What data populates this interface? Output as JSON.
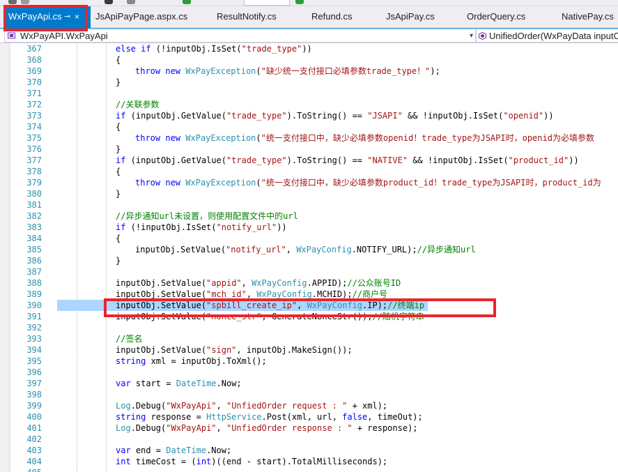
{
  "tabs": [
    {
      "label": "WxPayApi.cs",
      "active": true
    },
    {
      "label": "JsApiPayPage.aspx.cs"
    },
    {
      "label": "ResultNotify.cs"
    },
    {
      "label": "Refund.cs"
    },
    {
      "label": "JsApiPay.cs"
    },
    {
      "label": "OrderQuery.cs"
    },
    {
      "label": "NativePay.cs"
    }
  ],
  "tab_icons": {
    "pin": "pin-icon",
    "close": "close-icon"
  },
  "navbar": {
    "class_scope": "WxPayAPI.WxPayApi",
    "member_scope": "UnifiedOrder(WxPayData inputOb"
  },
  "colors": {
    "accent": "#007acc",
    "line_numbers": "#2b91af",
    "keyword": "#0000ff",
    "string": "#a31515",
    "type": "#2b91af",
    "comment": "#008000",
    "selection": "#add6ff",
    "annotation_red": "#e8262b"
  },
  "code": [
    {
      "num": "367",
      "indent": 3,
      "tokens": [
        {
          "t": "else if",
          "c": "kw"
        },
        {
          "t": " (!inputObj.IsSet(",
          "c": "plain"
        },
        {
          "t": "\"trade_type\"",
          "c": "str"
        },
        {
          "t": "))",
          "c": "plain"
        }
      ]
    },
    {
      "num": "368",
      "indent": 3,
      "tokens": [
        {
          "t": "{",
          "c": "plain"
        }
      ]
    },
    {
      "num": "369",
      "indent": 4,
      "tokens": [
        {
          "t": "throw new",
          "c": "kw"
        },
        {
          "t": " ",
          "c": "plain"
        },
        {
          "t": "WxPayException",
          "c": "type"
        },
        {
          "t": "(",
          "c": "plain"
        },
        {
          "t": "\"缺少统一支付接口必填参数trade_type！\"",
          "c": "str"
        },
        {
          "t": ");",
          "c": "plain"
        }
      ]
    },
    {
      "num": "370",
      "indent": 3,
      "tokens": [
        {
          "t": "}",
          "c": "plain"
        }
      ]
    },
    {
      "num": "371",
      "indent": 0,
      "tokens": []
    },
    {
      "num": "372",
      "indent": 3,
      "tokens": [
        {
          "t": "//关联参数",
          "c": "cm"
        }
      ]
    },
    {
      "num": "373",
      "indent": 3,
      "tokens": [
        {
          "t": "if",
          "c": "kw"
        },
        {
          "t": " (inputObj.GetValue(",
          "c": "plain"
        },
        {
          "t": "\"trade_type\"",
          "c": "str"
        },
        {
          "t": ").ToString() == ",
          "c": "plain"
        },
        {
          "t": "\"JSAPI\"",
          "c": "str"
        },
        {
          "t": " && !inputObj.IsSet(",
          "c": "plain"
        },
        {
          "t": "\"openid\"",
          "c": "str"
        },
        {
          "t": "))",
          "c": "plain"
        }
      ]
    },
    {
      "num": "374",
      "indent": 3,
      "tokens": [
        {
          "t": "{",
          "c": "plain"
        }
      ]
    },
    {
      "num": "375",
      "indent": 4,
      "tokens": [
        {
          "t": "throw new",
          "c": "kw"
        },
        {
          "t": " ",
          "c": "plain"
        },
        {
          "t": "WxPayException",
          "c": "type"
        },
        {
          "t": "(",
          "c": "plain"
        },
        {
          "t": "\"统一支付接口中，缺少必填参数openid！trade_type为JSAPI时，openid为必填参数",
          "c": "str"
        }
      ]
    },
    {
      "num": "376",
      "indent": 3,
      "tokens": [
        {
          "t": "}",
          "c": "plain"
        }
      ]
    },
    {
      "num": "377",
      "indent": 3,
      "tokens": [
        {
          "t": "if",
          "c": "kw"
        },
        {
          "t": " (inputObj.GetValue(",
          "c": "plain"
        },
        {
          "t": "\"trade_type\"",
          "c": "str"
        },
        {
          "t": ").ToString() == ",
          "c": "plain"
        },
        {
          "t": "\"NATIVE\"",
          "c": "str"
        },
        {
          "t": " && !inputObj.IsSet(",
          "c": "plain"
        },
        {
          "t": "\"product_id\"",
          "c": "str"
        },
        {
          "t": "))",
          "c": "plain"
        }
      ]
    },
    {
      "num": "378",
      "indent": 3,
      "tokens": [
        {
          "t": "{",
          "c": "plain"
        }
      ]
    },
    {
      "num": "379",
      "indent": 4,
      "tokens": [
        {
          "t": "throw new",
          "c": "kw"
        },
        {
          "t": " ",
          "c": "plain"
        },
        {
          "t": "WxPayException",
          "c": "type"
        },
        {
          "t": "(",
          "c": "plain"
        },
        {
          "t": "\"统一支付接口中，缺少必填参数product_id！trade_type为JSAPI时，product_id为",
          "c": "str"
        }
      ]
    },
    {
      "num": "380",
      "indent": 3,
      "tokens": [
        {
          "t": "}",
          "c": "plain"
        }
      ]
    },
    {
      "num": "381",
      "indent": 0,
      "tokens": []
    },
    {
      "num": "382",
      "indent": 3,
      "tokens": [
        {
          "t": "//异步通知url未设置，则使用配置文件中的url",
          "c": "cm"
        }
      ]
    },
    {
      "num": "383",
      "indent": 3,
      "tokens": [
        {
          "t": "if",
          "c": "kw"
        },
        {
          "t": " (!inputObj.IsSet(",
          "c": "plain"
        },
        {
          "t": "\"notify_url\"",
          "c": "str"
        },
        {
          "t": "))",
          "c": "plain"
        }
      ]
    },
    {
      "num": "384",
      "indent": 3,
      "tokens": [
        {
          "t": "{",
          "c": "plain"
        }
      ]
    },
    {
      "num": "385",
      "indent": 4,
      "tokens": [
        {
          "t": "inputObj.SetValue(",
          "c": "plain"
        },
        {
          "t": "\"notify_url\"",
          "c": "str"
        },
        {
          "t": ", ",
          "c": "plain"
        },
        {
          "t": "WxPayConfig",
          "c": "type"
        },
        {
          "t": ".NOTIFY_URL);",
          "c": "plain"
        },
        {
          "t": "//异步通知url",
          "c": "cm"
        }
      ]
    },
    {
      "num": "386",
      "indent": 3,
      "tokens": [
        {
          "t": "}",
          "c": "plain"
        }
      ]
    },
    {
      "num": "387",
      "indent": 0,
      "tokens": []
    },
    {
      "num": "388",
      "indent": 3,
      "tokens": [
        {
          "t": "inputObj.SetValue(",
          "c": "plain"
        },
        {
          "t": "\"appid\"",
          "c": "str"
        },
        {
          "t": ", ",
          "c": "plain"
        },
        {
          "t": "WxPayConfig",
          "c": "type"
        },
        {
          "t": ".APPID);",
          "c": "plain"
        },
        {
          "t": "//公众账号ID",
          "c": "cm"
        }
      ]
    },
    {
      "num": "389",
      "indent": 3,
      "tokens": [
        {
          "t": "inputObj.SetValue(",
          "c": "plain"
        },
        {
          "t": "\"mch_id\"",
          "c": "str"
        },
        {
          "t": ", ",
          "c": "plain"
        },
        {
          "t": "WxPayConfig",
          "c": "type"
        },
        {
          "t": ".MCHID);",
          "c": "plain"
        },
        {
          "t": "//商户号",
          "c": "cm"
        }
      ]
    },
    {
      "num": "390",
      "indent": 3,
      "selected": true,
      "tokens": [
        {
          "t": "inputObj.SetValue(",
          "c": "plain"
        },
        {
          "t": "\"spbill_create_ip\"",
          "c": "str"
        },
        {
          "t": ", ",
          "c": "plain"
        },
        {
          "t": "WxPayConfig",
          "c": "type"
        },
        {
          "t": ".IP);",
          "c": "plain"
        },
        {
          "t": "//终端ip",
          "c": "cm"
        }
      ]
    },
    {
      "num": "391",
      "indent": 3,
      "tokens": [
        {
          "t": "inputObj.SetValue(",
          "c": "plain"
        },
        {
          "t": "\"nonce_str\"",
          "c": "str"
        },
        {
          "t": ", GenerateNonceStr());",
          "c": "plain"
        },
        {
          "t": "//随机字符串",
          "c": "cm"
        }
      ]
    },
    {
      "num": "392",
      "indent": 0,
      "tokens": []
    },
    {
      "num": "393",
      "indent": 3,
      "tokens": [
        {
          "t": "//签名",
          "c": "cm"
        }
      ]
    },
    {
      "num": "394",
      "indent": 3,
      "tokens": [
        {
          "t": "inputObj.SetValue(",
          "c": "plain"
        },
        {
          "t": "\"sign\"",
          "c": "str"
        },
        {
          "t": ", inputObj.MakeSign());",
          "c": "plain"
        }
      ]
    },
    {
      "num": "395",
      "indent": 3,
      "tokens": [
        {
          "t": "string",
          "c": "kw"
        },
        {
          "t": " xml = inputObj.ToXml();",
          "c": "plain"
        }
      ]
    },
    {
      "num": "396",
      "indent": 0,
      "tokens": []
    },
    {
      "num": "397",
      "indent": 3,
      "tokens": [
        {
          "t": "var",
          "c": "kw"
        },
        {
          "t": " start = ",
          "c": "plain"
        },
        {
          "t": "DateTime",
          "c": "type"
        },
        {
          "t": ".Now;",
          "c": "plain"
        }
      ]
    },
    {
      "num": "398",
      "indent": 0,
      "tokens": []
    },
    {
      "num": "399",
      "indent": 3,
      "tokens": [
        {
          "t": "Log",
          "c": "type"
        },
        {
          "t": ".Debug(",
          "c": "plain"
        },
        {
          "t": "\"WxPayApi\"",
          "c": "str"
        },
        {
          "t": ", ",
          "c": "plain"
        },
        {
          "t": "\"UnfiedOrder request : \"",
          "c": "str"
        },
        {
          "t": " + xml);",
          "c": "plain"
        }
      ]
    },
    {
      "num": "400",
      "indent": 3,
      "tokens": [
        {
          "t": "string",
          "c": "kw"
        },
        {
          "t": " response = ",
          "c": "plain"
        },
        {
          "t": "HttpService",
          "c": "type"
        },
        {
          "t": ".Post(xml, url, ",
          "c": "plain"
        },
        {
          "t": "false",
          "c": "kw"
        },
        {
          "t": ", timeOut);",
          "c": "plain"
        }
      ]
    },
    {
      "num": "401",
      "indent": 3,
      "tokens": [
        {
          "t": "Log",
          "c": "type"
        },
        {
          "t": ".Debug(",
          "c": "plain"
        },
        {
          "t": "\"WxPayApi\"",
          "c": "str"
        },
        {
          "t": ", ",
          "c": "plain"
        },
        {
          "t": "\"UnfiedOrder response : \"",
          "c": "str"
        },
        {
          "t": " + response);",
          "c": "plain"
        }
      ]
    },
    {
      "num": "402",
      "indent": 0,
      "tokens": []
    },
    {
      "num": "403",
      "indent": 3,
      "tokens": [
        {
          "t": "var",
          "c": "kw"
        },
        {
          "t": " end = ",
          "c": "plain"
        },
        {
          "t": "DateTime",
          "c": "type"
        },
        {
          "t": ".Now;",
          "c": "plain"
        }
      ]
    },
    {
      "num": "404",
      "indent": 3,
      "tokens": [
        {
          "t": "int",
          "c": "kw"
        },
        {
          "t": " timeCost = (",
          "c": "plain"
        },
        {
          "t": "int",
          "c": "kw"
        },
        {
          "t": ")((end - start).TotalMilliseconds);",
          "c": "plain"
        }
      ]
    },
    {
      "num": "405",
      "indent": 0,
      "tokens": []
    }
  ]
}
